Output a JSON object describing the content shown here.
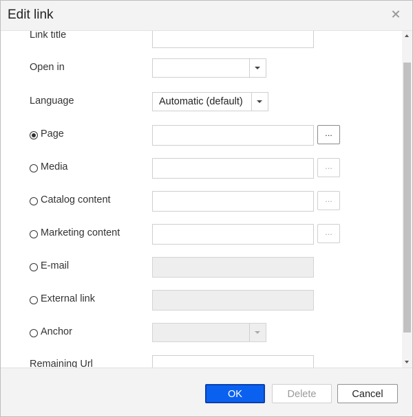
{
  "dialog": {
    "title": "Edit link",
    "close_icon": "close-icon"
  },
  "form": {
    "link_title": {
      "label": "Link title",
      "value": ""
    },
    "open_in": {
      "label": "Open in",
      "value": ""
    },
    "language": {
      "label": "Language",
      "value": "Automatic (default)"
    },
    "page": {
      "label": "Page",
      "value": "",
      "browse": "...",
      "selected": true
    },
    "media": {
      "label": "Media",
      "value": "",
      "browse": "..."
    },
    "catalog_content": {
      "label": "Catalog content",
      "value": "",
      "browse": "..."
    },
    "marketing_content": {
      "label": "Marketing content",
      "value": "",
      "browse": "..."
    },
    "email": {
      "label": "E-mail",
      "value": ""
    },
    "external_link": {
      "label": "External link",
      "value": ""
    },
    "anchor": {
      "label": "Anchor",
      "value": ""
    },
    "remaining_url": {
      "label": "Remaining Url",
      "value": ""
    }
  },
  "footer": {
    "ok_label": "OK",
    "delete_label": "Delete",
    "cancel_label": "Cancel"
  },
  "colors": {
    "primary_button": "#0b61ef",
    "header_bg": "#f3f3f3",
    "disabled_field": "#eeeeee"
  }
}
